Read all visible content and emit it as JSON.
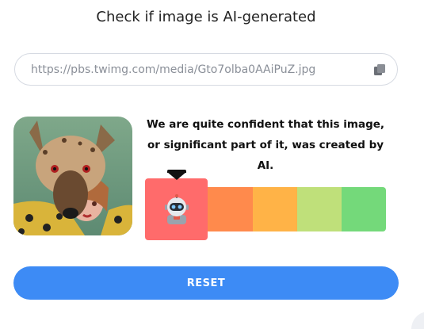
{
  "header": {
    "title": "Check if image is AI-generated"
  },
  "url_input": {
    "value": "https://pbs.twimg.com/media/Gto7olba0AAiPuZ.jpg"
  },
  "result": {
    "verdict": "We are quite confident that this image, or significant part of it, was created by AI.",
    "meter": {
      "selected_index": 0,
      "colors": [
        "#ff6b6b",
        "#ff8a4c",
        "#ffb347",
        "#bfe07a",
        "#74d97a"
      ],
      "selected_icon": "robot-icon"
    }
  },
  "actions": {
    "reset_label": "RESET"
  }
}
